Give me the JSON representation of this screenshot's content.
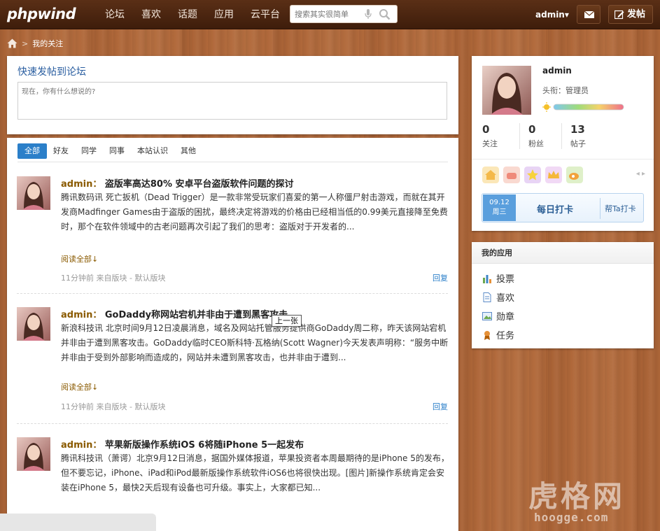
{
  "header": {
    "logo": "phpwind",
    "nav": [
      "论坛",
      "喜欢",
      "话题",
      "应用",
      "云平台"
    ],
    "search_placeholder": "搜索其实很简单",
    "user": "admin▾",
    "post_label": "发帖"
  },
  "breadcrumb": {
    "current": "我的关注"
  },
  "quick_post": {
    "title": "快速发帖到论坛",
    "placeholder": "现在，你有什么想说的?"
  },
  "feed": {
    "tabs": [
      "全部",
      "好友",
      "同学",
      "同事",
      "本站认识",
      "其他"
    ],
    "posts": [
      {
        "author": "admin：",
        "title": "盗版率高达80% 安卓平台盗版软件问题的探讨",
        "body": "腾讯数码讯 死亡扳机（Dead Trigger）是一款非常受玩家们喜爱的第一人称僵尸射击游戏，而就在其开发商Madfinger Games由于盗版的困扰，最终决定将游戏的价格由已经相当低的0.99美元直接降至免费时，那个在软件领域中的古老问题再次引起了我们的思考：盗版对于开发者的...",
        "more": "阅读全部↓",
        "meta": "11分钟前 来自版块 - 默认版块",
        "reply": "回复"
      },
      {
        "author": "admin：",
        "title": "GoDaddy称网站宕机并非由于遭到黑客攻击",
        "body": "新浪科技讯 北京时间9月12日凌晨消息，域名及网站托管服务提供商GoDaddy周二称，昨天该网站宕机并非由于遭到黑客攻击。GoDaddy临时CEO斯科特·瓦格纳(Scott Wagner)今天发表声明称：“服务中断并非由于受到外部影响而造成的，网站并未遭到黑客攻击，也并非由于遭到...",
        "more": "阅读全部↓",
        "meta": "11分钟前 来自版块 - 默认版块",
        "reply": "回复"
      },
      {
        "author": "admin：",
        "title": "苹果新版操作系统iOS 6将随iPhone 5一起发布",
        "body": "腾讯科技讯（萧谔）北京9月12日消息，据国外媒体报道，苹果投资者本周最期待的是iPhone 5的发布，但不要忘记，iPhone、iPad和iPod最新版操作系统软件iOS6也将很快出现。[图片]新操作系统肯定会安装在iPhone 5，最快2天后现有设备也可升级。事实上，大家都已知..."
      }
    ],
    "tooltip": "上一张"
  },
  "profile": {
    "name": "admin",
    "rank": "头衔：管理员",
    "stats": [
      {
        "num": "0",
        "label": "关注"
      },
      {
        "num": "0",
        "label": "粉丝"
      },
      {
        "num": "13",
        "label": "帖子"
      }
    ],
    "punch": {
      "date": "09.12",
      "weekday": "周三",
      "label": "每日打卡",
      "help": "帮Ta打卡"
    }
  },
  "apps": {
    "title": "我的应用",
    "items": [
      "投票",
      "喜欢",
      "勋章",
      "任务"
    ]
  },
  "watermark": {
    "title": "虎格网",
    "sub": "hoogge.com"
  },
  "colors": {
    "accent": "#2b7fc9",
    "wood": "#b0683a",
    "topbar": "#4a2410",
    "author": "#8a5a00"
  }
}
